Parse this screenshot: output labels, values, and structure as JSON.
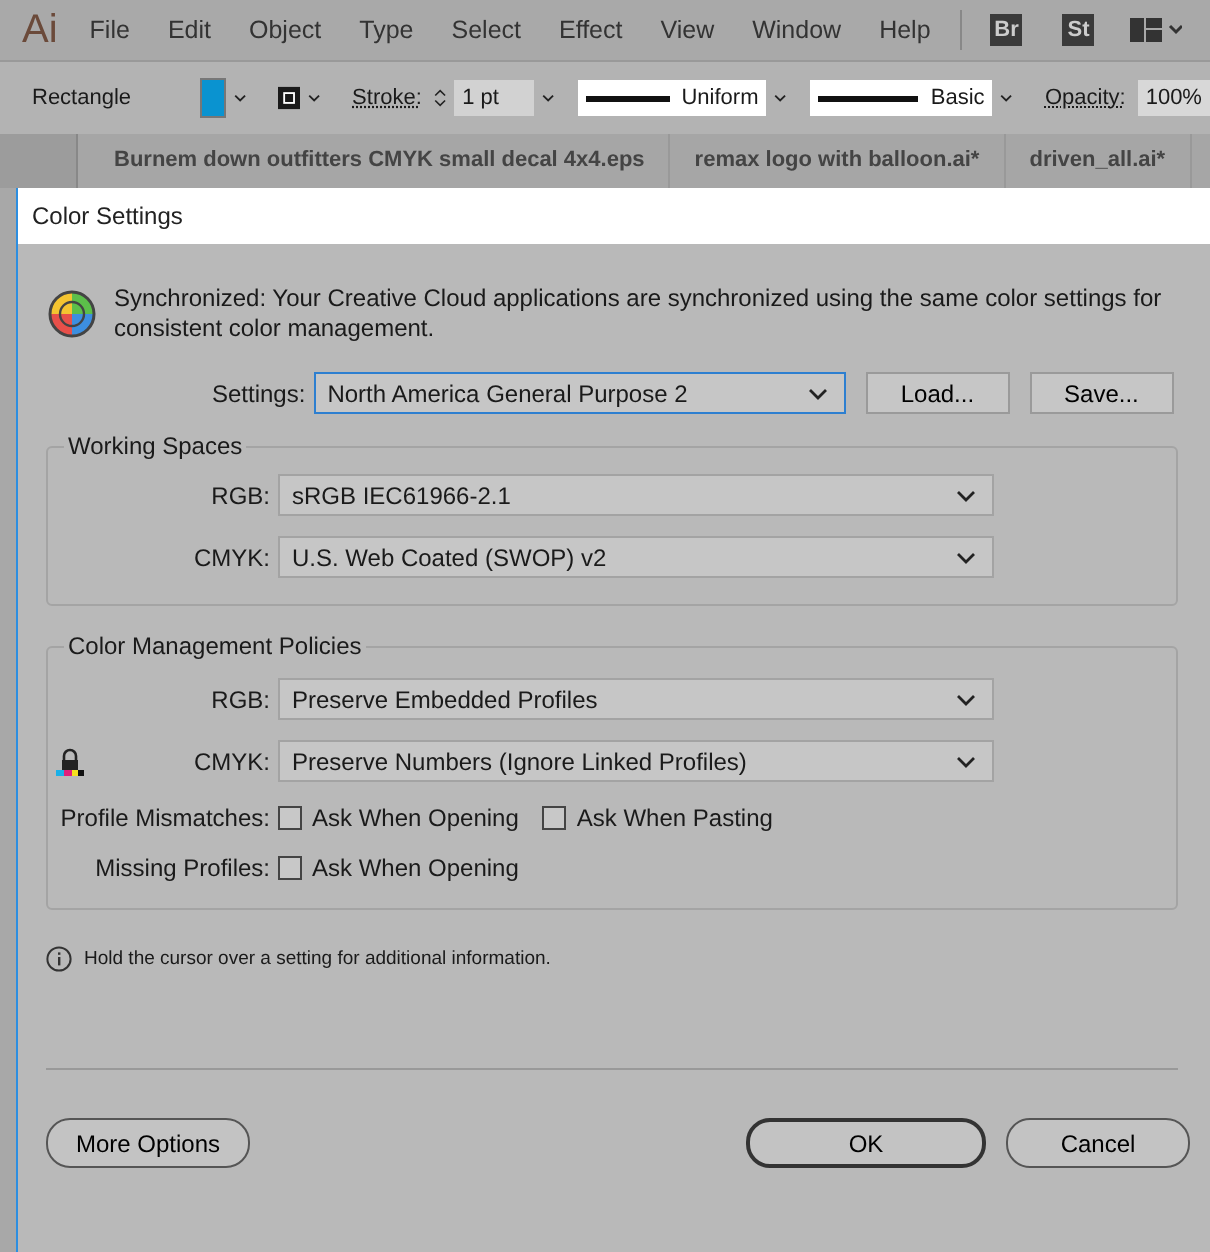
{
  "menu_bar": {
    "logo": "Ai",
    "items": [
      "File",
      "Edit",
      "Object",
      "Type",
      "Select",
      "Effect",
      "View",
      "Window",
      "Help"
    ],
    "app_buttons": [
      "Br",
      "St"
    ]
  },
  "control_bar": {
    "tool": "Rectangle",
    "stroke_label": "Stroke:",
    "stroke_weight": "1 pt",
    "stroke_profile": "Uniform",
    "brush": "Basic",
    "opacity_label": "Opacity:",
    "opacity_value": "100%"
  },
  "document_tabs": [
    {
      "label": "Burnem down outfitters CMYK small decal 4x4.eps",
      "selected": false
    },
    {
      "label": "remax logo with balloon.ai*",
      "selected": false
    },
    {
      "label": "driven_all.ai*",
      "selected": false
    }
  ],
  "dialog": {
    "title": "Color Settings",
    "sync_message": "Synchronized: Your Creative Cloud applications are synchronized using the same color settings for consistent color management.",
    "settings_label": "Settings:",
    "settings_value": "North America General Purpose 2",
    "load_button": "Load...",
    "save_button": "Save...",
    "working_spaces": {
      "title": "Working Spaces",
      "rows": [
        {
          "label": "RGB:",
          "value": "sRGB IEC61966-2.1"
        },
        {
          "label": "CMYK:",
          "value": "U.S. Web Coated (SWOP) v2"
        }
      ]
    },
    "policies": {
      "title": "Color Management Policies",
      "rows": [
        {
          "label": "RGB:",
          "value": "Preserve Embedded Profiles",
          "locked": false
        },
        {
          "label": "CMYK:",
          "value": "Preserve Numbers (Ignore Linked Profiles)",
          "locked": true
        }
      ],
      "profile_mismatches": {
        "label": "Profile Mismatches:",
        "options": [
          {
            "label": "Ask When Opening",
            "checked": false
          },
          {
            "label": "Ask When Pasting",
            "checked": false
          }
        ]
      },
      "missing_profiles": {
        "label": "Missing Profiles:",
        "options": [
          {
            "label": "Ask When Opening",
            "checked": false
          }
        ]
      }
    },
    "info": "Hold the cursor over a setting for additional information.",
    "buttons": {
      "more": "More Options",
      "ok": "OK",
      "cancel": "Cancel"
    }
  }
}
